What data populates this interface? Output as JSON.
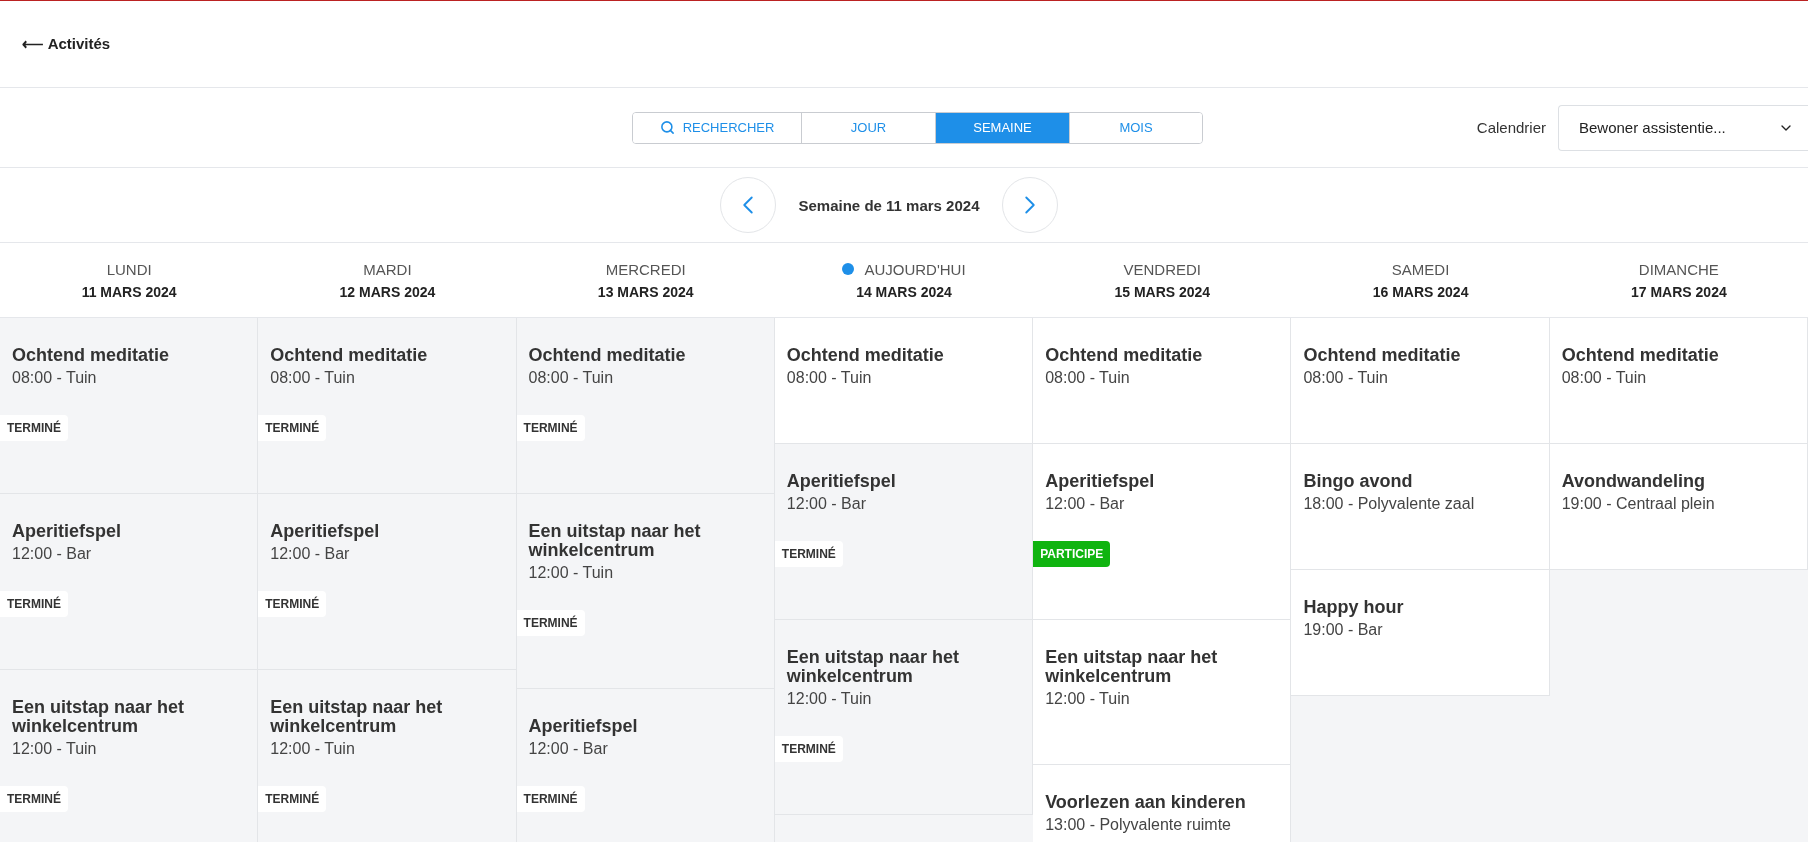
{
  "back": {
    "arrow": "⟵",
    "label": "Activités"
  },
  "views": [
    {
      "kind": "search",
      "label": "RECHERCHER",
      "selected": false
    },
    {
      "kind": "plain",
      "label": "JOUR",
      "selected": false
    },
    {
      "kind": "plain",
      "label": "SEMAINE",
      "selected": true
    },
    {
      "kind": "plain",
      "label": "MOIS",
      "selected": false
    }
  ],
  "calendar": {
    "label": "Calendrier",
    "value": "Bewoner assistentie..."
  },
  "week": {
    "title": "Semaine de 11 mars 2024"
  },
  "days": [
    {
      "name": "LUNDI",
      "date": "11 MARS 2024",
      "today": false,
      "events": [
        {
          "title": "Ochtend meditatie",
          "time": "08:00 - Tuin",
          "badge": {
            "kind": "done",
            "label": "TERMINÉ"
          }
        },
        {
          "title": "Aperitiefspel",
          "time": "12:00 - Bar",
          "badge": {
            "kind": "done",
            "label": "TERMINÉ"
          }
        },
        {
          "title": "Een uitstap naar het winkelcentrum",
          "time": "12:00 - Tuin",
          "badge": {
            "kind": "done",
            "label": "TERMINÉ"
          }
        }
      ]
    },
    {
      "name": "MARDI",
      "date": "12 MARS 2024",
      "today": false,
      "events": [
        {
          "title": "Ochtend meditatie",
          "time": "08:00 - Tuin",
          "badge": {
            "kind": "done",
            "label": "TERMINÉ"
          }
        },
        {
          "title": "Aperitiefspel",
          "time": "12:00 - Bar",
          "badge": {
            "kind": "done",
            "label": "TERMINÉ"
          }
        },
        {
          "title": "Een uitstap naar het winkelcentrum",
          "time": "12:00 - Tuin",
          "badge": {
            "kind": "done",
            "label": "TERMINÉ"
          }
        }
      ]
    },
    {
      "name": "MERCREDI",
      "date": "13 MARS 2024",
      "today": false,
      "events": [
        {
          "title": "Ochtend meditatie",
          "time": "08:00 - Tuin",
          "badge": {
            "kind": "done",
            "label": "TERMINÉ"
          }
        },
        {
          "title": "Een uitstap naar het winkelcentrum",
          "time": "12:00 - Tuin",
          "badge": {
            "kind": "done",
            "label": "TERMINÉ"
          }
        },
        {
          "title": "Aperitiefspel",
          "time": "12:00 - Bar",
          "badge": {
            "kind": "done",
            "label": "TERMINÉ"
          }
        }
      ]
    },
    {
      "name": "AUJOURD'HUI",
      "date": "14 MARS 2024",
      "today": true,
      "events": [
        {
          "title": "Ochtend meditatie",
          "time": "08:00 - Tuin"
        },
        {
          "title": "Aperitiefspel",
          "time": "12:00 - Bar",
          "badge": {
            "kind": "done",
            "label": "TERMINÉ"
          }
        },
        {
          "title": "Een uitstap naar het winkelcentrum",
          "time": "12:00 - Tuin",
          "badge": {
            "kind": "done",
            "label": "TERMINÉ"
          }
        }
      ]
    },
    {
      "name": "VENDREDI",
      "date": "15 MARS 2024",
      "today": false,
      "events": [
        {
          "title": "Ochtend meditatie",
          "time": "08:00 - Tuin"
        },
        {
          "title": "Aperitiefspel",
          "time": "12:00 - Bar",
          "badge": {
            "kind": "joined",
            "label": "PARTICIPE"
          }
        },
        {
          "title": "Een uitstap naar het winkelcentrum",
          "time": "12:00 - Tuin"
        },
        {
          "title": "Voorlezen aan kinderen",
          "time": "13:00 - Polyvalente ruimte"
        }
      ]
    },
    {
      "name": "SAMEDI",
      "date": "16 MARS 2024",
      "today": false,
      "events": [
        {
          "title": "Ochtend meditatie",
          "time": "08:00 - Tuin"
        },
        {
          "title": "Bingo avond",
          "time": "18:00 - Polyvalente zaal"
        },
        {
          "title": "Happy hour",
          "time": "19:00 - Bar"
        }
      ]
    },
    {
      "name": "DIMANCHE",
      "date": "17 MARS 2024",
      "today": false,
      "events": [
        {
          "title": "Ochtend meditatie",
          "time": "08:00 - Tuin"
        },
        {
          "title": "Avondwandeling",
          "time": "19:00 - Centraal plein"
        }
      ]
    }
  ]
}
